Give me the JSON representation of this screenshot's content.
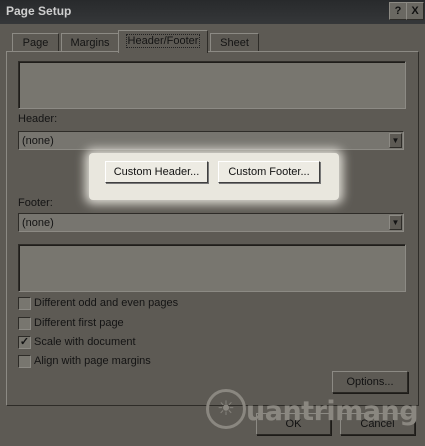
{
  "window": {
    "title": "Page Setup",
    "help_label": "?",
    "close_label": "X"
  },
  "tabs": [
    {
      "label": "Page"
    },
    {
      "label": "Margins"
    },
    {
      "label": "Header/Footer",
      "active": true
    },
    {
      "label": "Sheet"
    }
  ],
  "header": {
    "label": "Header:",
    "value": "(none)",
    "custom_button": "Custom Header..."
  },
  "footer": {
    "label": "Footer:",
    "value": "(none)",
    "custom_button": "Custom Footer..."
  },
  "options": [
    {
      "label": "Different odd and even pages",
      "checked": false
    },
    {
      "label": "Different first page",
      "checked": false
    },
    {
      "label": "Scale with document",
      "checked": true
    },
    {
      "label": "Align with page margins",
      "checked": false
    }
  ],
  "buttons": {
    "options": "Options...",
    "ok": "OK",
    "cancel": "Cancel"
  },
  "watermark": {
    "text_plain": "uantrimang",
    "icon": "lightbulb-icon"
  }
}
